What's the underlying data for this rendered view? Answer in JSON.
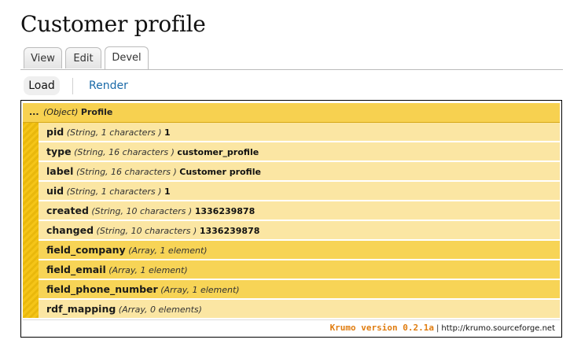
{
  "page": {
    "title": "Customer profile"
  },
  "tabs": [
    {
      "label": "View"
    },
    {
      "label": "Edit"
    },
    {
      "label": "Devel"
    }
  ],
  "subtabs": {
    "load": "Load",
    "render": "Render"
  },
  "krumo": {
    "root": {
      "ellipsis": "...",
      "type": "(Object)",
      "name": "Profile"
    },
    "rows": [
      {
        "key": "pid",
        "type": "(String, 1 characters )",
        "value": "1"
      },
      {
        "key": "type",
        "type": "(String, 16 characters )",
        "value": "customer_profile"
      },
      {
        "key": "label",
        "type": "(String, 16 characters )",
        "value": "Customer profile"
      },
      {
        "key": "uid",
        "type": "(String, 1 characters )",
        "value": "1"
      },
      {
        "key": "created",
        "type": "(String, 10 characters )",
        "value": "1336239878"
      },
      {
        "key": "changed",
        "type": "(String, 10 characters )",
        "value": "1336239878"
      },
      {
        "key": "field_company",
        "type": "(Array, 1 element)",
        "value": ""
      },
      {
        "key": "field_email",
        "type": "(Array, 1 element)",
        "value": ""
      },
      {
        "key": "field_phone_number",
        "type": "(Array, 1 element)",
        "value": ""
      },
      {
        "key": "rdf_mapping",
        "type": "(Array, 0 elements)",
        "value": ""
      }
    ],
    "footer": {
      "version": "Krumo version 0.2.1a",
      "separator": "|",
      "link": "http://krumo.sourceforge.net"
    }
  },
  "colors": {
    "root_bg": "#f7d150",
    "leaf_bg": "#fbe6a3",
    "expandable_bg": "#f7d456",
    "version_text": "#e07d10",
    "link_text": "#1a6aa8"
  }
}
